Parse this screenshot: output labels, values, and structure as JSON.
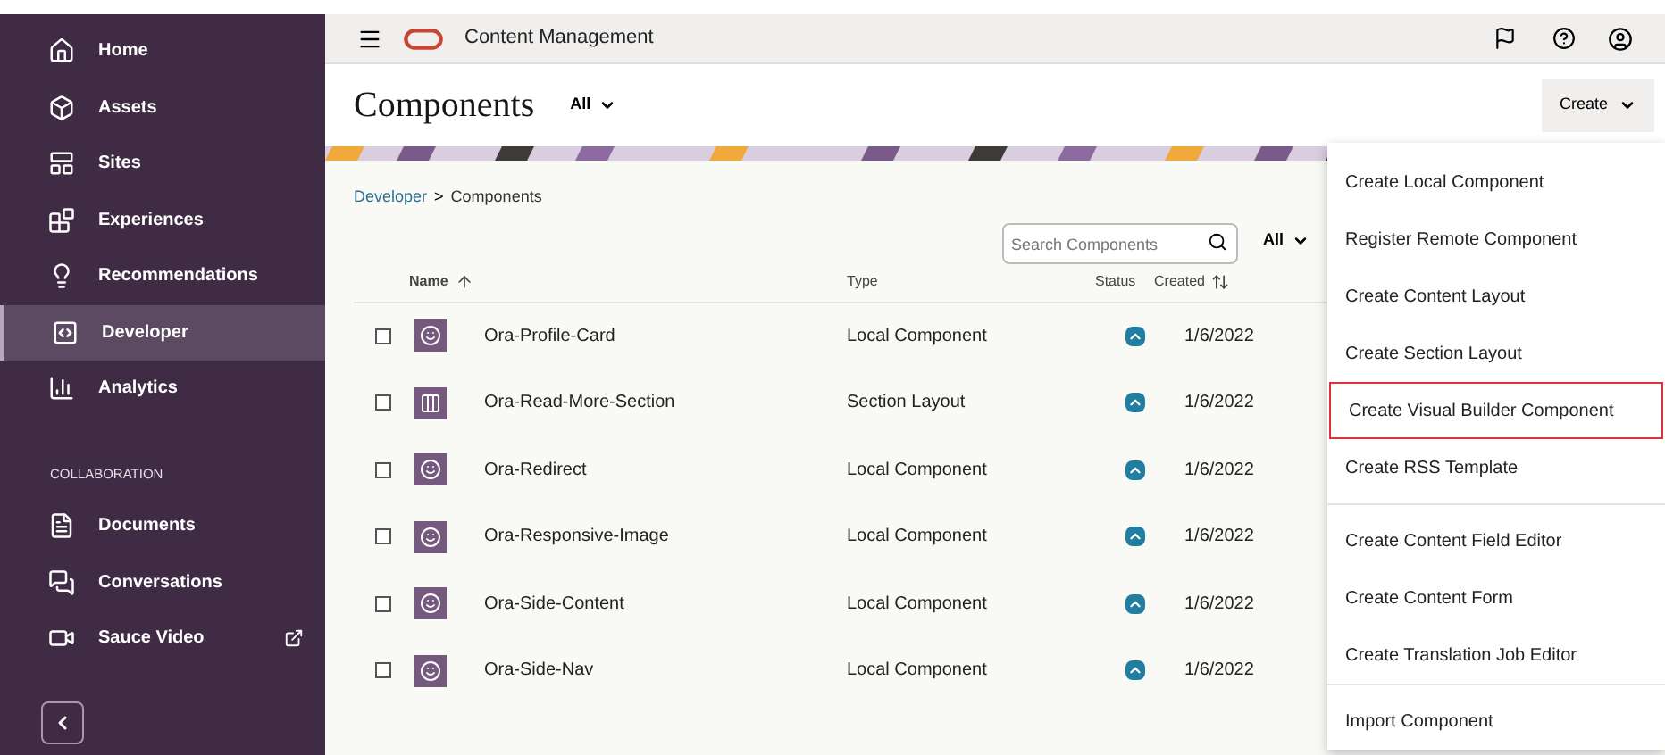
{
  "sidebar": {
    "items": [
      {
        "label": "Home",
        "kind": "home",
        "selected": false
      },
      {
        "label": "Assets",
        "kind": "box",
        "selected": false
      },
      {
        "label": "Sites",
        "kind": "sites",
        "selected": false
      },
      {
        "label": "Experiences",
        "kind": "experiences",
        "selected": false
      },
      {
        "label": "Recommendations",
        "kind": "bulb",
        "selected": false
      },
      {
        "label": "Developer",
        "kind": "code",
        "selected": true
      },
      {
        "label": "Analytics",
        "kind": "chart",
        "selected": false
      }
    ],
    "section_title": "COLLABORATION",
    "collab_items": [
      {
        "label": "Documents",
        "kind": "doc",
        "selected": false
      },
      {
        "label": "Conversations",
        "kind": "chat",
        "selected": false
      },
      {
        "label": "Sauce Video",
        "kind": "video",
        "selected": false,
        "external": true
      }
    ]
  },
  "topbar": {
    "title": "Content Management"
  },
  "header": {
    "title": "Components",
    "filter": "All",
    "create_button": "Create"
  },
  "breadcrumb": {
    "link": "Developer",
    "separator": ">",
    "current": "Components"
  },
  "search": {
    "placeholder": "Search Components"
  },
  "type_filter": "All",
  "table": {
    "columns": [
      "Name",
      "Type",
      "Status",
      "Created"
    ],
    "rows": [
      {
        "name": "Ora-Profile-Card",
        "type": "Local Component",
        "kind": "component",
        "checked": false,
        "created": "1/6/2022"
      },
      {
        "name": "Ora-Read-More-Section",
        "type": "Section Layout",
        "kind": "section",
        "checked": false,
        "created": "1/6/2022"
      },
      {
        "name": "Ora-Redirect",
        "type": "Local Component",
        "kind": "component",
        "checked": false,
        "created": "1/6/2022"
      },
      {
        "name": "Ora-Responsive-Image",
        "type": "Local Component",
        "kind": "component",
        "checked": false,
        "created": "1/6/2022"
      },
      {
        "name": "Ora-Side-Content",
        "type": "Local Component",
        "kind": "component",
        "checked": false,
        "created": "1/6/2022"
      },
      {
        "name": "Ora-Side-Nav",
        "type": "Local Component",
        "kind": "component",
        "checked": false,
        "created": "1/6/2022"
      }
    ]
  },
  "create_menu": {
    "groups": [
      [
        {
          "label": "Create Local Component",
          "highlighted": false
        },
        {
          "label": "Register Remote Component",
          "highlighted": false
        },
        {
          "label": "Create Content Layout",
          "highlighted": false
        },
        {
          "label": "Create Section Layout",
          "highlighted": false
        },
        {
          "label": "Create Visual Builder Component",
          "highlighted": true
        },
        {
          "label": "Create RSS Template",
          "highlighted": false
        }
      ],
      [
        {
          "label": "Create Content Field Editor",
          "highlighted": false
        },
        {
          "label": "Create Content Form",
          "highlighted": false
        },
        {
          "label": "Create Translation Job Editor",
          "highlighted": false
        }
      ],
      [
        {
          "label": "Import Component",
          "highlighted": false
        }
      ]
    ]
  }
}
